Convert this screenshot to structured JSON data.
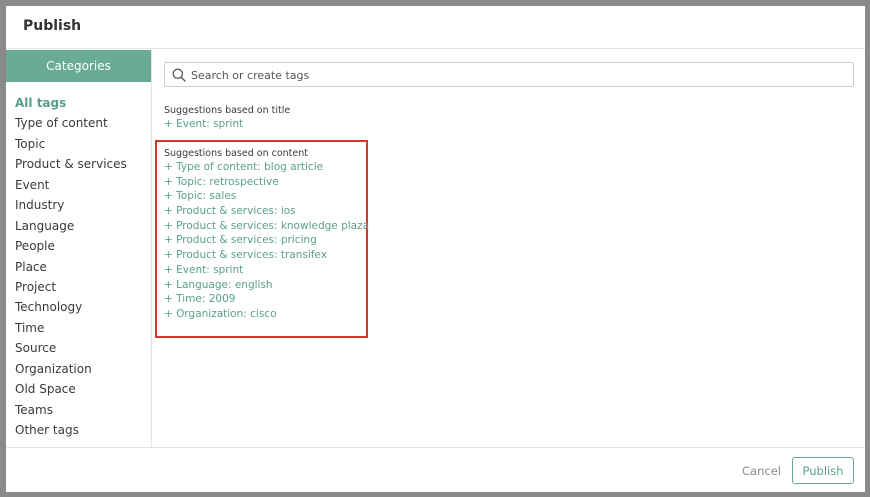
{
  "dialog": {
    "title": "Publish"
  },
  "sidebar": {
    "header": "Categories",
    "items": [
      {
        "label": "All tags",
        "active": true
      },
      {
        "label": "Type of content"
      },
      {
        "label": "Topic"
      },
      {
        "label": "Product & services"
      },
      {
        "label": "Event"
      },
      {
        "label": "Industry"
      },
      {
        "label": "Language"
      },
      {
        "label": "People"
      },
      {
        "label": "Place"
      },
      {
        "label": "Project"
      },
      {
        "label": "Technology"
      },
      {
        "label": "Time"
      },
      {
        "label": "Source"
      },
      {
        "label": "Organization"
      },
      {
        "label": "Old Space"
      },
      {
        "label": "Teams"
      },
      {
        "label": "Other tags"
      }
    ]
  },
  "search": {
    "placeholder": "Search or create tags",
    "value": ""
  },
  "suggestions_title": {
    "heading": "Suggestions based on title",
    "tags": [
      "+ Event: sprint"
    ]
  },
  "suggestions_content": {
    "heading": "Suggestions based on content",
    "tags": [
      "+ Type of content: blog article",
      "+ Topic: retrospective",
      "+ Topic: sales",
      "+ Product & services: ios",
      "+ Product & services: knowledge plaza",
      "+ Product & services: pricing",
      "+ Product & services: transifex",
      "+ Event: sprint",
      "+ Language: english",
      "+ Time: 2009",
      "+ Organization: cisco"
    ]
  },
  "footer": {
    "cancel_label": "Cancel",
    "publish_label": "Publish"
  },
  "colors": {
    "accent": "#6aab98",
    "tag_text": "#5aa08a",
    "highlight_border": "#d2382b",
    "backdrop": "#8a8a8a"
  }
}
